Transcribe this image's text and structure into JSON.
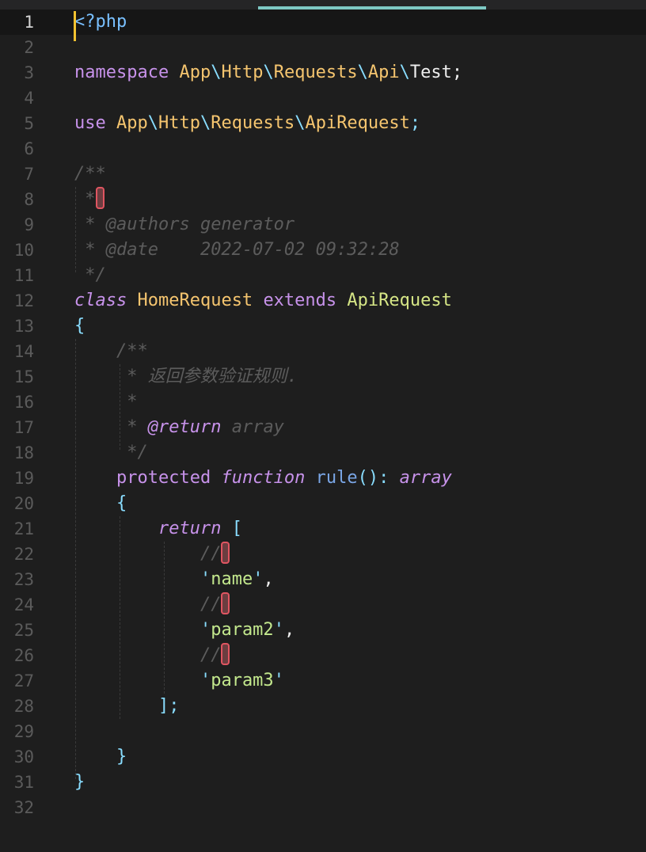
{
  "editor": {
    "active_line": "1",
    "line_numbers": [
      "1",
      "2",
      "3",
      "4",
      "5",
      "6",
      "7",
      "8",
      "9",
      "10",
      "11",
      "12",
      "13",
      "14",
      "15",
      "16",
      "17",
      "18",
      "19",
      "20",
      "21",
      "22",
      "23",
      "24",
      "25",
      "26",
      "27",
      "28",
      "29",
      "30",
      "31",
      "32"
    ],
    "tokens": {
      "php_open": "<?php",
      "namespace_kw": "namespace",
      "ns_app": "App",
      "ns_http": "Http",
      "ns_requests": "Requests",
      "ns_api": "Api",
      "ns_test": "Test",
      "backslash": "\\",
      "semicolon": ";",
      "use_kw": "use",
      "ns_apirequest": "ApiRequest",
      "doc_open": "/**",
      "doc_star": "*",
      "doc_authors": "* @authors generator",
      "doc_date": "* @date    2022-07-02 09:32:28",
      "doc_close": "*/",
      "class_kw": "class",
      "class_name": "HomeRequest",
      "extends_kw": "extends",
      "parent_class": "ApiRequest",
      "brace_open": "{",
      "brace_close": "}",
      "doc2_desc": "* 返回参数验证规则.",
      "doc2_return_tag": "@return",
      "doc2_return_type": "array",
      "protected_kw": "protected",
      "function_kw": "function",
      "fn_name": "rule",
      "fn_parens": "():",
      "return_type": "array",
      "return_kw": "return",
      "bracket_open": "[",
      "line_comment": "//",
      "quote": "'",
      "str_name": "name",
      "str_param2": "param2",
      "str_param3": "param3",
      "comma": ",",
      "bracket_close": "];"
    }
  },
  "colors": {
    "background": "#1e1e1e",
    "cursor": "#f2c230",
    "scroll_indicator": "#7ec9c4",
    "keyword": "#c792ea",
    "namespace": "#f5c56f",
    "string": "#c3e88d",
    "function": "#7aa6e6",
    "punctuation": "#89ddff",
    "comment": "#5c5c5c",
    "marker_border": "#e05561"
  }
}
